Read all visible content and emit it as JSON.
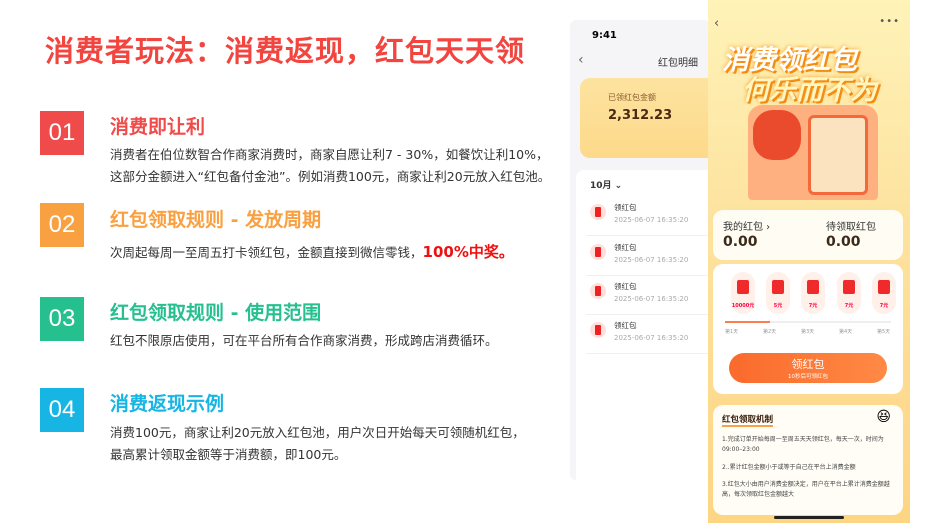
{
  "title": "消费者玩法：消费返现，红包天天领",
  "sections": [
    {
      "num": "01",
      "color": "#f04b4b",
      "heading": "消费即让利",
      "lines": [
        "消费者在伯位数智合作商家消费时，商家自愿让利7 - 30%，如餐饮让利10%，",
        "这部分金额进入“红包备付金池”。例如消费100元，商家让利20元放入红包池。"
      ]
    },
    {
      "num": "02",
      "color": "#f9a040",
      "heading": "红包领取规则 - 发放周期",
      "lines": [
        "次周起每周一至周五打卡领红包，金额直接到微信零钱，"
      ],
      "highlight": "100%中奖。"
    },
    {
      "num": "03",
      "color": "#26c08e",
      "heading": "红包领取规则 - 使用范围",
      "lines": [
        "红包不限原店使用，可在平台所有合作商家消费，形成跨店消费循环。"
      ]
    },
    {
      "num": "04",
      "color": "#16b5e3",
      "heading": "消费返现示例",
      "lines": [
        "消费100元，商家让利20元放入红包池，用户次日开始每天可领随机红包，",
        "最高累计领取金额等于消费额，即100元。"
      ]
    }
  ],
  "phone1": {
    "time": "9:41",
    "nav_title": "红包明细",
    "received_label": "已领红包金额",
    "received_value": "2,312.23",
    "month": "10月",
    "items": [
      {
        "title": "领红包",
        "date": "2025-06-07 16:35:20"
      },
      {
        "title": "领红包",
        "date": "2025-06-07 16:35:20"
      },
      {
        "title": "领红包",
        "date": "2025-06-07 16:35:20"
      },
      {
        "title": "领红包",
        "date": "2025-06-07 16:35:20"
      }
    ]
  },
  "phone2": {
    "more": "•••",
    "banner1": "消费领红包",
    "banner2": "何乐而不为",
    "my_label": "我的红包 ›",
    "my_value": "0.00",
    "pending_label": "待领取红包",
    "pending_value": "0.00",
    "envelopes": [
      "10000元",
      "5元",
      "7元",
      "7元",
      "7元"
    ],
    "days": [
      "第1天",
      "第2天",
      "第3天",
      "第4天",
      "第5天"
    ],
    "progress": 0.27,
    "button": "领红包",
    "button_sub": "10秒后可领红包",
    "rules_title": "红包领取机制",
    "rules": [
      "1.完成订单开始每周一至周五天天领红包，每天一次，时间为09:00–23:00",
      "2..累计红包金额小于或等于自己在平台上消费金额",
      "3.红包大小由用户消费金额决定，用户在平台上累计消费金额越高，每次领取红包金额越大"
    ]
  }
}
